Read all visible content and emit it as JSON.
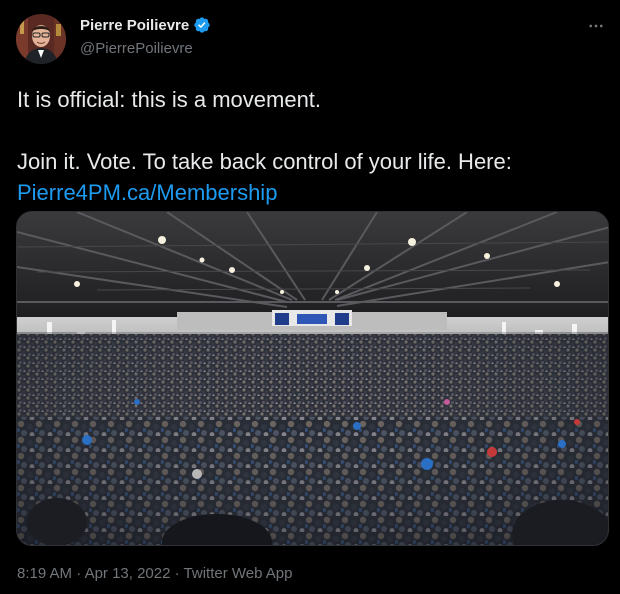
{
  "author": {
    "name": "Pierre Poilievre",
    "handle": "@PierrePoilievre",
    "verified_icon": "verified-badge-icon"
  },
  "tweet": {
    "line1": "It is official: this is a movement.",
    "line2": "Join it. Vote. To take back control of your life. Here:",
    "link": "Pierre4PM.ca/Membership"
  },
  "media": {
    "icon": "photo-icon"
  },
  "meta": {
    "time": "8:19 AM",
    "separator": " · ",
    "date": "Apr 13, 2022",
    "source": "Twitter Web App"
  },
  "colors": {
    "background": "#000000",
    "text": "#e7e9ea",
    "secondary": "#71767b",
    "link": "#1d9bf0",
    "verified": "#1d9bf0"
  }
}
